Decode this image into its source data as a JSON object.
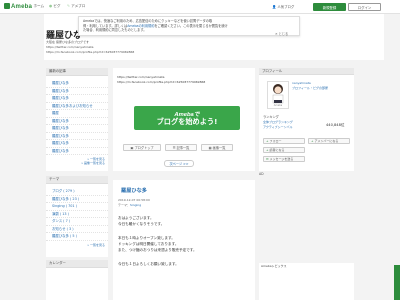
{
  "topbar": {
    "logo": "Ameba",
    "nav": [
      "ホーム",
      "ピグ",
      "アメブロ"
    ],
    "official": "芸能人ブログ",
    "official2": "人気ブログ",
    "register": "新規登録",
    "login": "ログイン"
  },
  "header": {
    "title": "羅屋ひな多のブ",
    "desc_lines": [
      "大阪在 羅屋ひな多のブログです",
      "https://twitter.com/nanyahinata",
      "https://m.facebook.com/profile.php?id=625087779969868"
    ]
  },
  "notice": {
    "text1": "Amebaでは、快適なご利用のため、広告配信のためにクッキーなどを使い訪問データの取",
    "text2": "得・利用しています。詳しくは",
    "link": "Amebaの利用規約",
    "text3": "をご確認ください。この表示を閉じるか閲覧を続け",
    "text4": "た場合、利用規約に同意したものとします。",
    "close": "✕ とじる"
  },
  "sidebar": {
    "new_entries": {
      "title": "最新の記事",
      "items": [
        "羅屋ひな多",
        "羅屋ひな多",
        "羅屋ひな多",
        "羅屋ひな多およびお知らせ",
        "羅屋",
        "羅屋ひな多",
        "羅屋ひな多",
        "羅屋ひな多",
        "羅屋ひな多",
        "羅屋ひな多"
      ],
      "more": "一覧を見る",
      "more2": "画像一覧を見る"
    },
    "themes": {
      "title": "テーマ",
      "items": [
        "ブログ ( 279 )",
        "羅屋ひな多 ( 23 )",
        "Singing ( 701 )",
        "演劇 ( 13 )",
        "ダンス ( 7 )",
        "お知らせ ( 3 )",
        "羅屋ひな多 ( 5 )"
      ],
      "more": "一覧を見る"
    },
    "calendar": {
      "title": "カレンダー"
    }
  },
  "main": {
    "urls": [
      "https://twitter.com/nanyahinata",
      "https://m.facebook.com/profile.php?id=625087779969868"
    ],
    "ameba_btn": {
      "line1": "Amebaで",
      "line2": "ブログを始めよう!"
    },
    "share": [
      "ブログトップ",
      "記事一覧",
      "画像一覧"
    ],
    "page_next": "次ページ >>",
    "article": {
      "title": "羅屋ひな多",
      "date": "2019-12-07 00:58:00",
      "theme_label": "テーマ：",
      "theme": "Singing",
      "lines": [
        "おはようございます。",
        "今日も暖かくなりそうです。",
        "",
        "本日も１時よりオープン致します。",
        "ドッキングは明日開催しております。",
        "また、つけ麺のおつりは来週より販売予定です。",
        "",
        "今日も１日よろしくお願い致します。"
      ]
    }
  },
  "right": {
    "profile_title": "プロフィール",
    "name": "nanyahinata",
    "role1": "ブロフィール・ピグの部屋",
    "avatar_caption": "Ameba",
    "ranking_label": "ランキング",
    "ranking_lines": [
      "全体ブログランキング",
      "アクティブシーンバル"
    ],
    "rank_value": "440,848位",
    "buttons": [
      "フォロー",
      "アメンバーになる",
      "読者になる",
      "メッセージを送る"
    ],
    "ad_label": "AD",
    "news_label": "Amebaトピックス"
  }
}
